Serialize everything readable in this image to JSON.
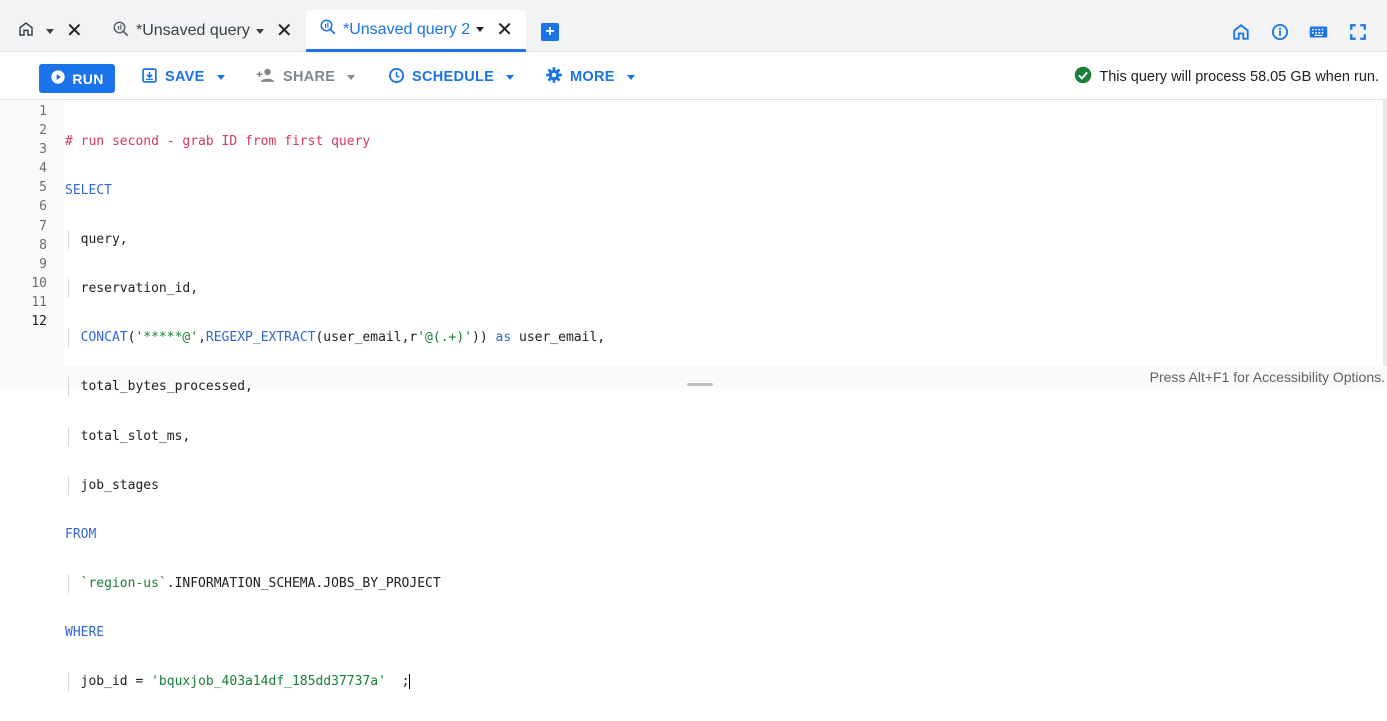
{
  "tabs": [
    {
      "label": "",
      "icon": "home-icon"
    },
    {
      "label": "*Unsaved query",
      "icon": "query-icon"
    },
    {
      "label": "*Unsaved query 2",
      "icon": "query-icon",
      "active": true
    }
  ],
  "tab_close_glyph": "✕",
  "add_tab_glyph": "+",
  "right_icons": [
    "home-icon",
    "info-icon",
    "keyboard-icon",
    "fullscreen-icon"
  ],
  "toolbar": {
    "run_label": "RUN",
    "save_label": "SAVE",
    "share_label": "SHARE",
    "schedule_label": "SCHEDULE",
    "more_label": "MORE",
    "status_text": "This query will process 58.05 GB when run."
  },
  "editor": {
    "line_numbers": [
      "1",
      "2",
      "3",
      "4",
      "5",
      "6",
      "7",
      "8",
      "9",
      "10",
      "11",
      "12"
    ],
    "current_line": "12",
    "lines": {
      "l1": "# run second - grab ID from first query",
      "l2": "SELECT",
      "l3": "query,",
      "l4": "reservation_id,",
      "l5_func": "CONCAT",
      "l5_open": "(",
      "l5_str1": "'*****@'",
      "l5_comma": ",",
      "l5_func2": "REGEXP_EXTRACT",
      "l5_mid": "(user_email,r",
      "l5_str2": "'@(.+)'",
      "l5_close": "))",
      "l5_as": "as",
      "l5_tail": " user_email,",
      "l6": "total_bytes_processed,",
      "l7": "total_slot_ms,",
      "l8": "job_stages",
      "l9": "FROM",
      "l10_str": "`region-us`",
      "l10_rest": ".INFORMATION_SCHEMA.JOBS_BY_PROJECT",
      "l11": "WHERE",
      "l12_pre": "job_id = ",
      "l12_str": "'bquxjob_403a14df_185dd37737a'",
      "l12_post": "  ;"
    },
    "accessibility_hint": "Press Alt+F1 for Accessibility Options."
  },
  "colors": {
    "accent": "#1a73e8",
    "keyword": "#3367d6",
    "comment": "#d6385c",
    "string": "#188038",
    "success": "#188038"
  }
}
